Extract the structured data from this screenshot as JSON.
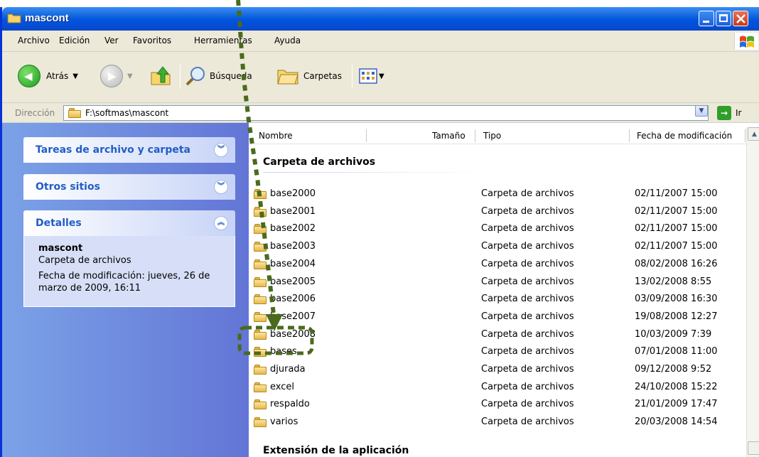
{
  "window": {
    "title": "mascont"
  },
  "menu": [
    "Archivo",
    "Edición",
    "Ver",
    "Favoritos",
    "Herramientas",
    "Ayuda"
  ],
  "toolbar": {
    "back": "Atrás",
    "search": "Búsqueda",
    "folders": "Carpetas"
  },
  "address": {
    "label": "Dirección",
    "value": "F:\\softmas\\mascont",
    "go": "Ir"
  },
  "sidebar": {
    "tasks": "Tareas de archivo y carpeta",
    "other": "Otros sitios",
    "details": {
      "title": "Detalles",
      "name": "mascont",
      "type": "Carpeta de archivos",
      "modified": "Fecha de modificación: jueves, 26 de marzo de 2009, 16:11"
    }
  },
  "columns": {
    "name": "Nombre",
    "size": "Tamaño",
    "type": "Tipo",
    "date": "Fecha de modificación"
  },
  "groups": {
    "folders": "Carpeta de archivos",
    "apps": "Extensión de la aplicación"
  },
  "files": [
    {
      "name": "base2000",
      "type": "Carpeta de archivos",
      "date": "02/11/2007 15:00"
    },
    {
      "name": "base2001",
      "type": "Carpeta de archivos",
      "date": "02/11/2007 15:00"
    },
    {
      "name": "base2002",
      "type": "Carpeta de archivos",
      "date": "02/11/2007 15:00"
    },
    {
      "name": "base2003",
      "type": "Carpeta de archivos",
      "date": "02/11/2007 15:00"
    },
    {
      "name": "base2004",
      "type": "Carpeta de archivos",
      "date": "08/02/2008 16:26"
    },
    {
      "name": "base2005",
      "type": "Carpeta de archivos",
      "date": "13/02/2008 8:55"
    },
    {
      "name": "base2006",
      "type": "Carpeta de archivos",
      "date": "03/09/2008 16:30"
    },
    {
      "name": "base2007",
      "type": "Carpeta de archivos",
      "date": "19/08/2008 12:27"
    },
    {
      "name": "base2008",
      "type": "Carpeta de archivos",
      "date": "10/03/2009 7:39"
    },
    {
      "name": "bases",
      "type": "Carpeta de archivos",
      "date": "07/01/2008 11:00"
    },
    {
      "name": "djurada",
      "type": "Carpeta de archivos",
      "date": "09/12/2008 9:52"
    },
    {
      "name": "excel",
      "type": "Carpeta de archivos",
      "date": "24/10/2008 15:22"
    },
    {
      "name": "respaldo",
      "type": "Carpeta de archivos",
      "date": "21/01/2009 17:47"
    },
    {
      "name": "varios",
      "type": "Carpeta de archivos",
      "date": "20/03/2008 14:54"
    }
  ],
  "colors": {
    "title_bar": "#0054e3",
    "sidebar": "#6b8ee0",
    "sidebar_heading": "#215dc6",
    "annotation": "#4a6a1c"
  }
}
